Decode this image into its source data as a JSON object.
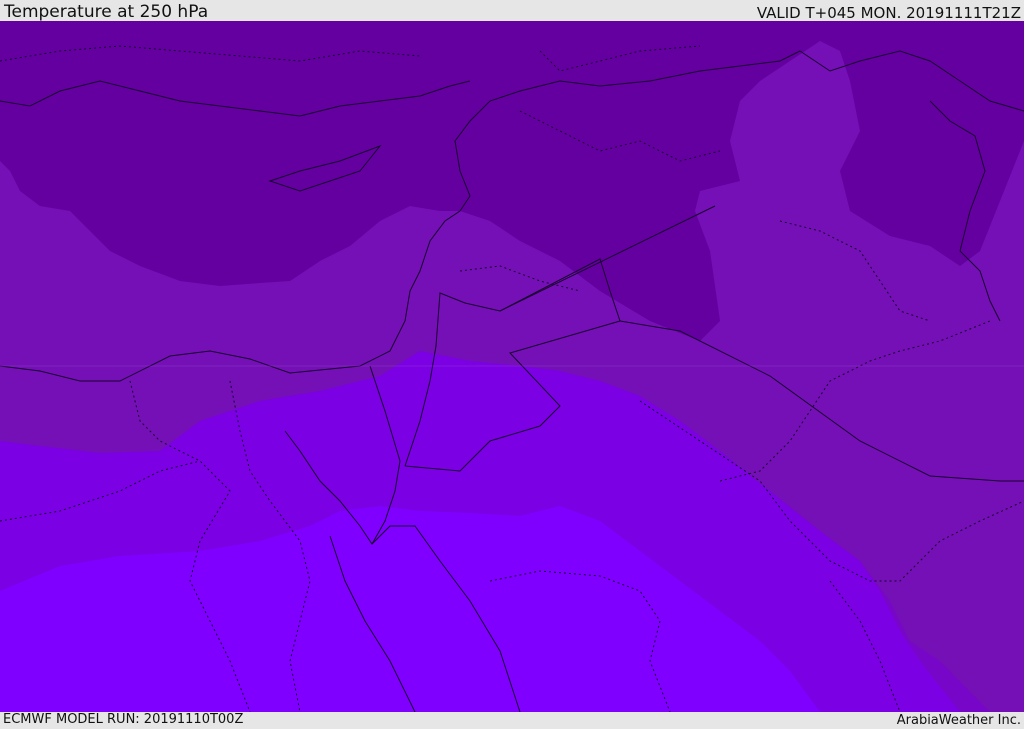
{
  "header": {
    "title": "Temperature at 250 hPa",
    "valid_time": "VALID T+045 MON. 20191111T21Z"
  },
  "footer": {
    "model_run": "ECMWF MODEL RUN: 20191110T00Z",
    "credit": "ArabiaWeather Inc."
  },
  "map": {
    "colors": {
      "band_darkest": "#6400a0",
      "band_dark": "#7410b5",
      "band_mid": "#7806c8",
      "band_light": "#7b00e6",
      "band_lightest": "#8000ff",
      "borders": "#1a0030"
    }
  }
}
